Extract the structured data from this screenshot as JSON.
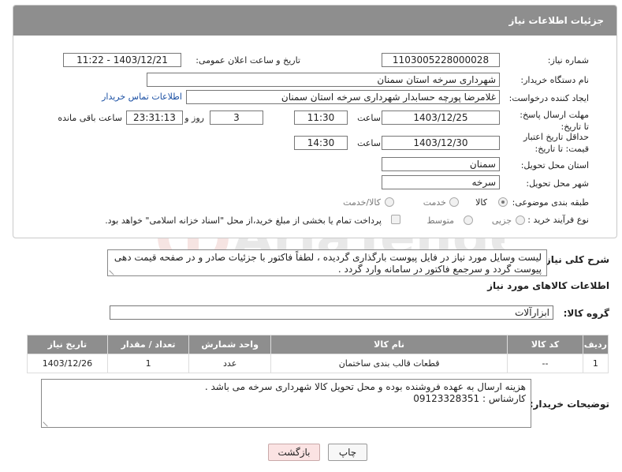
{
  "header": {
    "title": "جزئیات اطلاعات نیاز"
  },
  "fields": {
    "need_number_label": "شماره نیاز:",
    "need_number": "1103005228000028",
    "announce_label": "تاریخ و ساعت اعلان عمومی:",
    "announce_value": "1403/12/21 - 11:22",
    "buyer_org_label": "نام دستگاه خریدار:",
    "buyer_org": "شهرداری سرخه استان سمنان",
    "creator_label": "ایجاد کننده درخواست:",
    "creator": "غلامرضا پورچه حسابدار شهرداری سرخه استان سمنان",
    "contact_link": "اطلاعات تماس خریدار",
    "reply_deadline_label": "مهلت ارسال پاسخ: تا تاریخ:",
    "reply_date": "1403/12/25",
    "time_label": "ساعت",
    "reply_time": "11:30",
    "days_value": "3",
    "days_label": "روز و",
    "remaining_time": "23:31:13",
    "remaining_label": "ساعت باقی مانده",
    "price_validity_label": "حداقل تاریخ اعتبار قیمت: تا تاریخ:",
    "validity_date": "1403/12/30",
    "validity_time": "14:30",
    "province_label": "استان محل تحویل:",
    "province": "سمنان",
    "city_label": "شهر محل تحویل:",
    "city": "سرخه",
    "category_label": "طبقه بندی موضوعی:",
    "category_options": [
      "کالا",
      "خدمت",
      "کالا/خدمت"
    ],
    "process_label": "نوع فرآیند خرید :",
    "process_options": [
      "جزیی",
      "متوسط"
    ],
    "payment_note": "پرداخت تمام یا بخشی از مبلغ خرید،از محل \"اسناد خزانه اسلامی\" خواهد بود."
  },
  "description": {
    "label": "شرح کلی نیاز:",
    "text": "لیست وسایل مورد نیاز در فایل پیوست بارگذاری گردیده ، لطفاً فاکتور با جزئیات صادر و در صفحه قیمت دهی\nپیوست گردد و سرجمع فاکتور در سامانه وارد گردد ."
  },
  "goods": {
    "section_title": "اطلاعات کالاهای مورد نیاز",
    "group_label": "گروه کالا:",
    "group_value": "ابزارآلات",
    "columns": [
      "ردیف",
      "کد کالا",
      "نام کالا",
      "واحد شمارش",
      "تعداد / مقدار",
      "تاریخ نیاز"
    ],
    "rows": [
      {
        "row": "1",
        "code": "--",
        "name": "قطعات قالب بندی ساختمان",
        "unit": "عدد",
        "qty": "1",
        "date": "1403/12/26"
      }
    ]
  },
  "buyer_notes": {
    "label": "توضیحات خریدار:",
    "text": "هزینه ارسال به عهده فروشنده بوده و محل تحویل کالا شهرداری سرخه می باشد .\nکارشناس : 09123328351"
  },
  "buttons": {
    "print": "چاپ",
    "back": "بازگشت"
  },
  "watermark": {
    "text": "AriaTender.neT",
    "color": "#c0392b"
  },
  "colors": {
    "header_bg": "#8e8e8e",
    "link": "#1a4fa3",
    "back_button_bg": "#fbe3e3"
  }
}
